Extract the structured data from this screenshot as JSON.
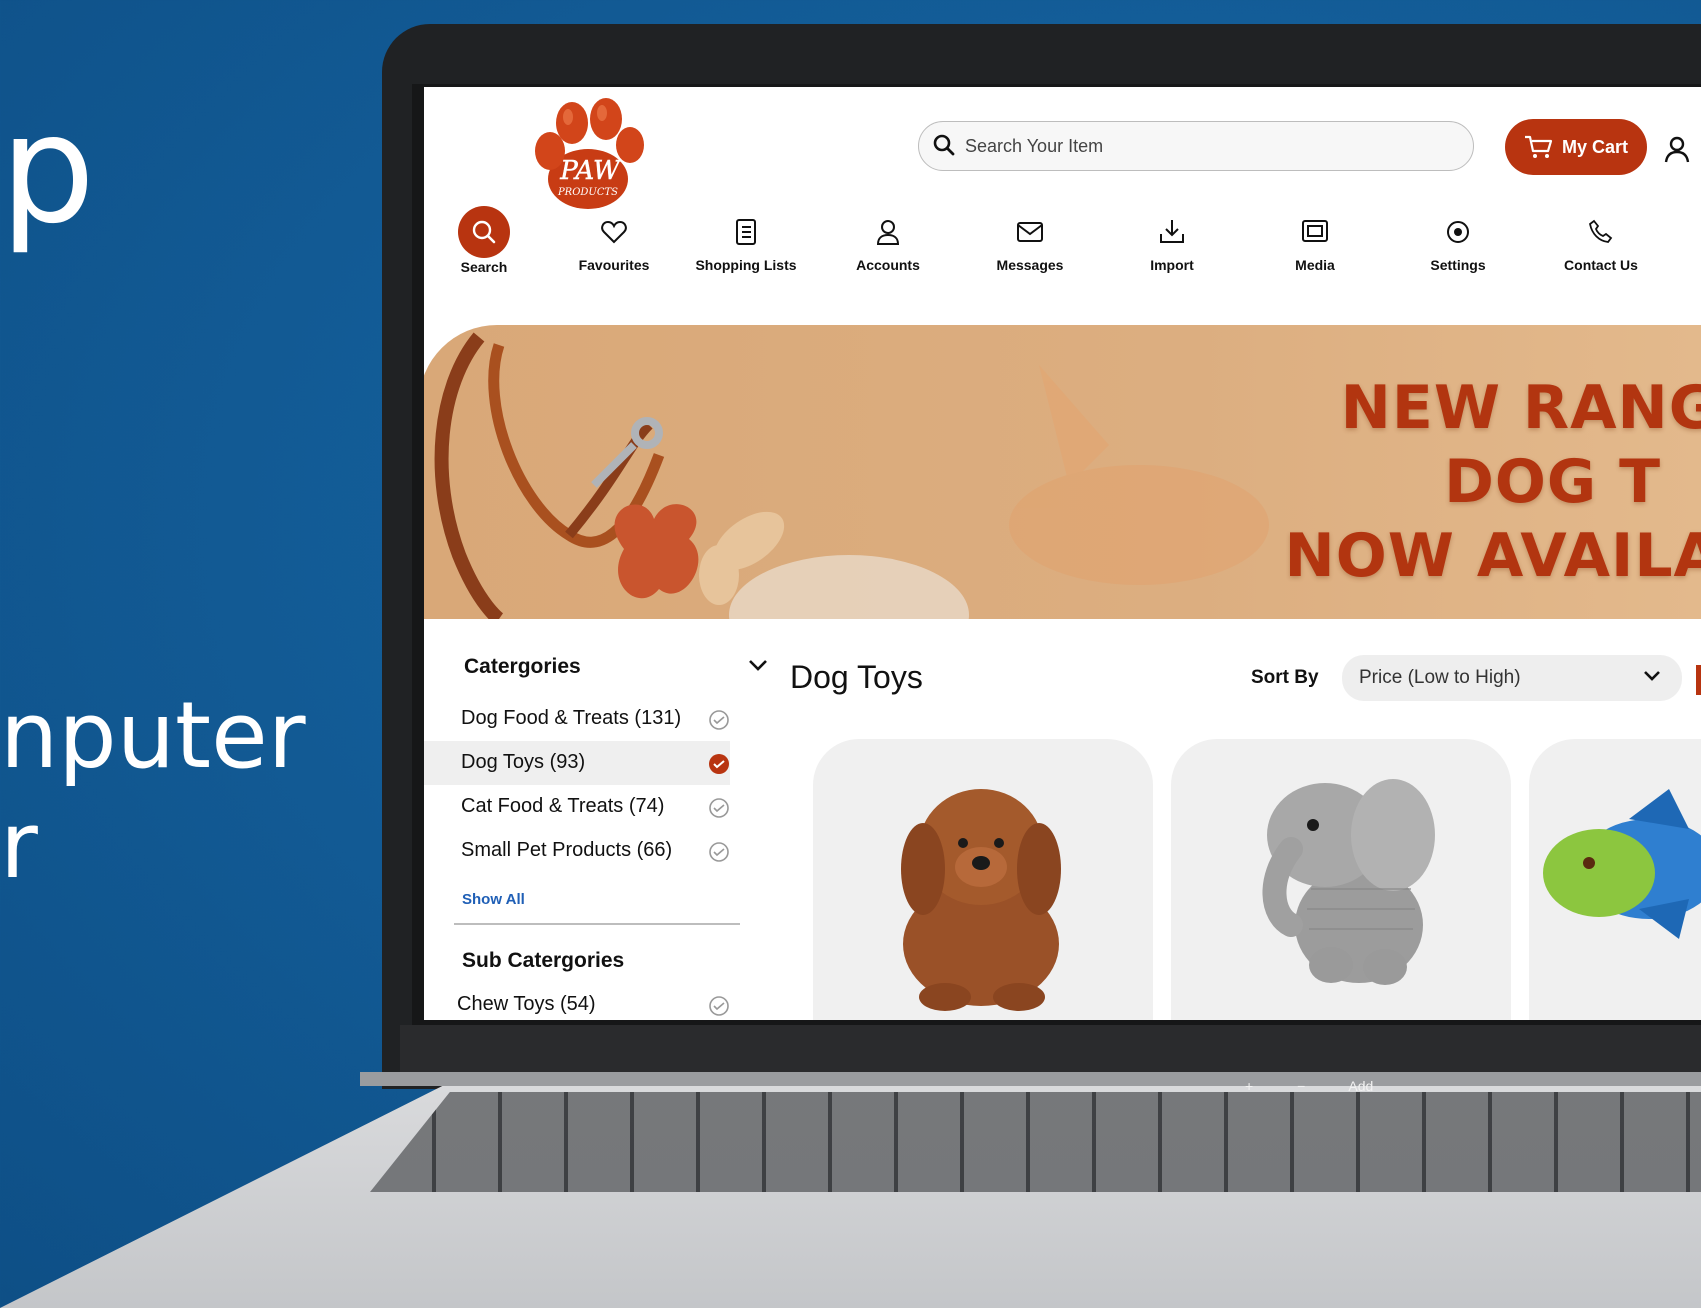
{
  "promo": {
    "line1": "p",
    "line2": "nputer",
    "line3": "r"
  },
  "header": {
    "search_placeholder": "Search Your Item",
    "cart_label": "My Cart"
  },
  "nav": [
    {
      "label": "Search",
      "icon": "search-icon"
    },
    {
      "label": "Favourites",
      "icon": "heart-icon"
    },
    {
      "label": "Shopping Lists",
      "icon": "list-icon"
    },
    {
      "label": "Accounts",
      "icon": "user-icon"
    },
    {
      "label": "Messages",
      "icon": "mail-icon"
    },
    {
      "label": "Import",
      "icon": "import-icon"
    },
    {
      "label": "Media",
      "icon": "media-icon"
    },
    {
      "label": "Settings",
      "icon": "eye-icon"
    },
    {
      "label": "Contact Us",
      "icon": "phone-icon"
    }
  ],
  "banner": {
    "line1": "NEW RANGE",
    "line2": "DOG T",
    "line3": "NOW AVAILA"
  },
  "sidebar": {
    "categories_title": "Catergories",
    "categories": [
      {
        "label": "Dog Food & Treats  (131)",
        "selected": false
      },
      {
        "label": "Dog Toys (93)",
        "selected": true
      },
      {
        "label": "Cat Food & Treats (74)",
        "selected": false
      },
      {
        "label": "Small Pet Products  (66)",
        "selected": false
      }
    ],
    "show_all": "Show All",
    "subcategories_title": "Sub Catergories",
    "subcategories": [
      {
        "label": "Chew Toys (54)",
        "selected": false
      }
    ]
  },
  "main": {
    "title": "Dog Toys",
    "sort_label": "Sort By",
    "sort_value": "Price (Low to High)"
  },
  "touchbar": {
    "plus": "+",
    "minus": "−",
    "add": "Add"
  },
  "colors": {
    "accent": "#b83410",
    "link": "#1f5fb6",
    "background": "#135d98"
  }
}
